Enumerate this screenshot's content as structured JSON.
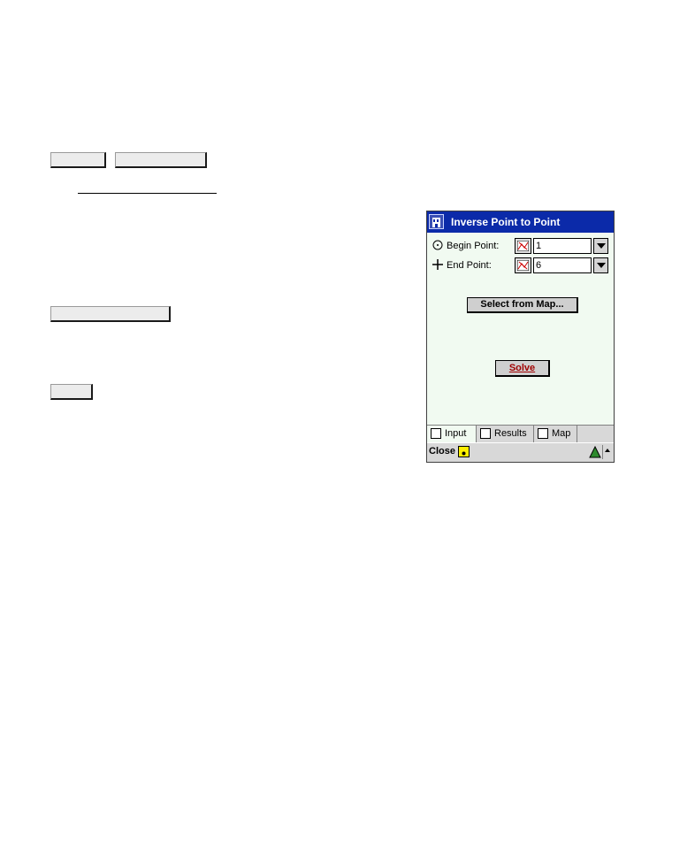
{
  "window": {
    "title": "Inverse Point to Point",
    "begin_point_label": "Begin Point:",
    "begin_point_value": "1",
    "end_point_label": "End Point:",
    "end_point_value": "6",
    "select_from_map_label": "Select from Map...",
    "solve_label": "Solve"
  },
  "tabs": [
    {
      "label": "Input"
    },
    {
      "label": "Results"
    },
    {
      "label": "Map"
    }
  ],
  "command_bar": {
    "close_label": "Close"
  }
}
